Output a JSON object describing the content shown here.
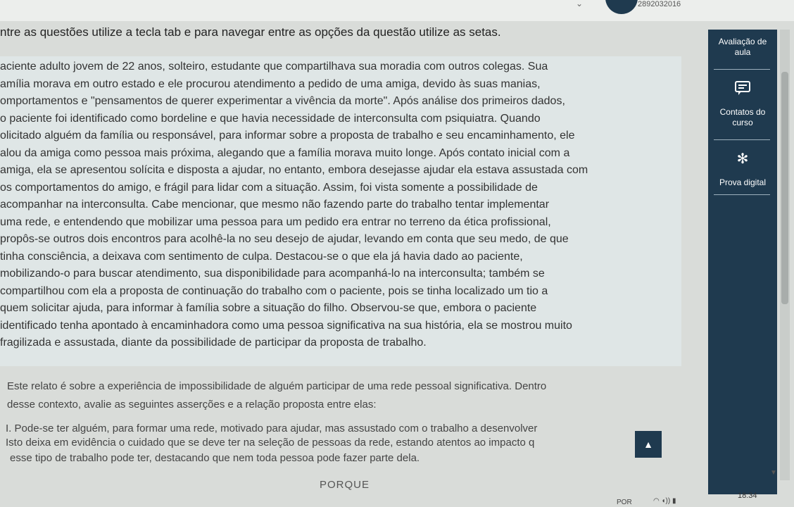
{
  "header": {
    "user_id": "2892032016"
  },
  "instruction": "ntre as questões utilize a tecla tab e para navegar entre as opções da questão utilize as setas.",
  "question_lines": [
    "aciente adulto jovem de 22 anos, solteiro, estudante que compartilhava sua moradia com outros colegas. Sua",
    "amília morava em outro estado e ele procurou atendimento a pedido de uma amiga, devido às suas manias,",
    "omportamentos e \"pensamentos de querer experimentar a vivência da morte\". Após análise dos primeiros dados,",
    "o paciente foi identificado como bordeline e que havia necessidade de interconsulta com psiquiatra. Quando",
    "olicitado alguém da família ou responsável, para informar sobre a proposta de trabalho e seu encaminhamento, ele",
    "alou da amiga como pessoa mais próxima, alegando que a família morava muito longe. Após contato inicial com a",
    "amiga, ela se apresentou solícita e disposta a ajudar, no entanto, embora desejasse ajudar ela estava assustada com",
    "os comportamentos do amigo, e frágil para lidar com a situação. Assim, foi vista somente a possibilidade de",
    "acompanhar na interconsulta. Cabe mencionar, que mesmo não fazendo parte do trabalho tentar implementar",
    "uma rede, e entendendo que mobilizar uma pessoa para um pedido era entrar no terreno da ética profissional,",
    "propôs-se outros dois encontros para acolhê-la no seu desejo de ajudar, levando em conta que seu medo, de que",
    "tinha consciência, a deixava com sentimento de culpa. Destacou-se o que ela já havia dado ao paciente,",
    "mobilizando-o para buscar atendimento, sua disponibilidade para acompanhá-lo na interconsulta; também se",
    "compartilhou com ela a proposta de continuação do trabalho com o paciente, pois se tinha localizado um tio a",
    "quem solicitar ajuda, para informar à família sobre a situação do filho. Observou-se que, embora o paciente",
    "identificado tenha apontado à encaminhadora como uma pessoa significativa na sua história, ela se mostrou muito",
    "fragilizada e assustada, diante da possibilidade de participar da proposta de trabalho."
  ],
  "assertion_lines": [
    "Este relato é sobre a experiência de impossibilidade de alguém participar de uma rede pessoal significativa. Dentro",
    "desse contexto, avalie as seguintes asserções e a relação proposta entre elas:",
    "I. Pode-se ter alguém, para formar uma rede, motivado para ajudar, mas assustado com o trabalho a desenvolver",
    "Isto deixa em evidência o cuidado que se deve ter na seleção de pessoas da rede, estando atentos ao impacto q",
    "esse tipo de trabalho pode ter, destacando que nem toda pessoa pode fazer parte dela."
  ],
  "porque": "PORQUE",
  "sidebar": {
    "avaliacao_line1": "Avaliação de",
    "avaliacao_line2": "aula",
    "contatos_line1": "Contatos do",
    "contatos_line2": "curso",
    "prova": "Prova digital"
  },
  "taskbar": {
    "time": "18:34",
    "lang": "POR"
  },
  "icons": {
    "contatos": "chat-icon",
    "prova": "snowflake-icon",
    "scroll_up": "chevron-up-icon"
  }
}
